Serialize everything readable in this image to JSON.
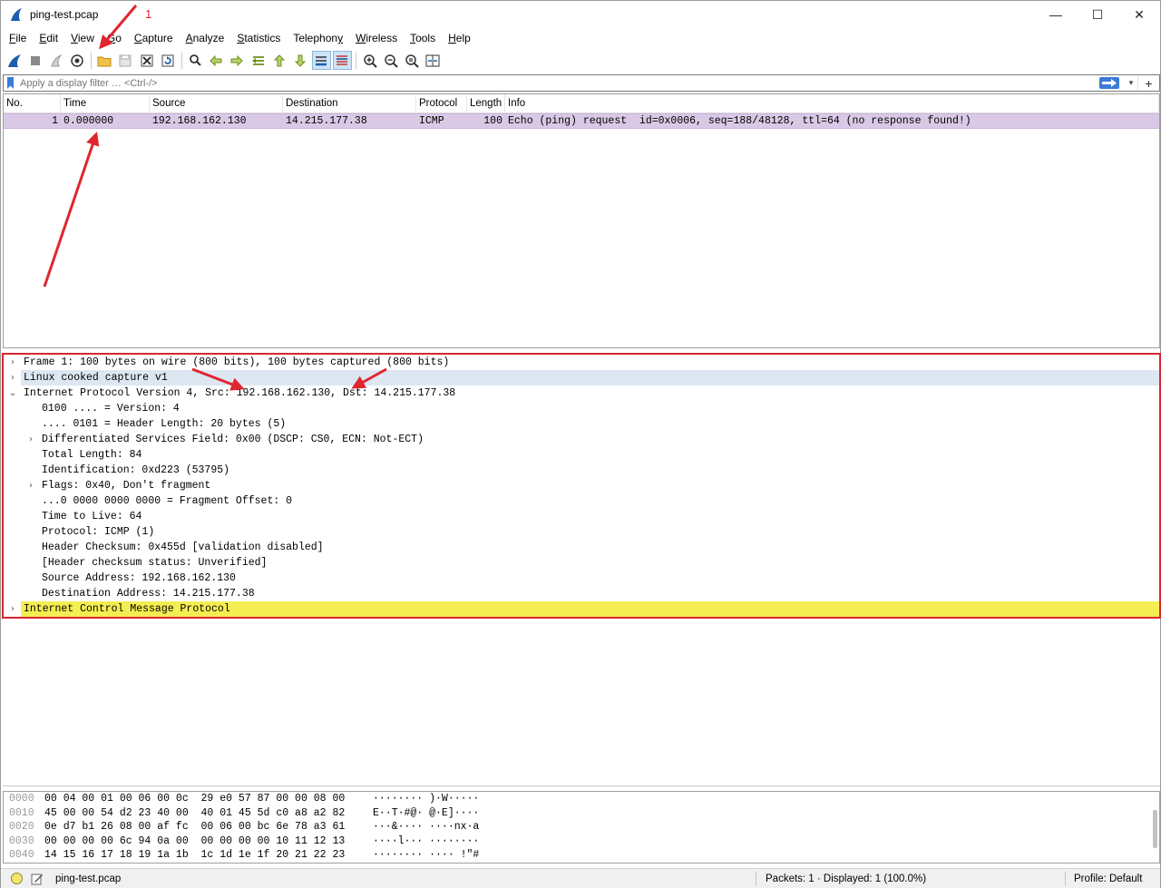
{
  "window": {
    "title": "ping-test.pcap",
    "controls": [
      "—",
      "☐",
      "✕"
    ]
  },
  "menu": [
    {
      "pre": "",
      "u": "F",
      "post": "ile"
    },
    {
      "pre": "",
      "u": "E",
      "post": "dit"
    },
    {
      "pre": "",
      "u": "V",
      "post": "iew"
    },
    {
      "pre": "",
      "u": "G",
      "post": "o"
    },
    {
      "pre": "",
      "u": "C",
      "post": "apture"
    },
    {
      "pre": "",
      "u": "A",
      "post": "nalyze"
    },
    {
      "pre": "",
      "u": "S",
      "post": "tatistics"
    },
    {
      "pre": "Telephon",
      "u": "y",
      "post": ""
    },
    {
      "pre": "",
      "u": "W",
      "post": "ireless"
    },
    {
      "pre": "",
      "u": "T",
      "post": "ools"
    },
    {
      "pre": "",
      "u": "H",
      "post": "elp"
    }
  ],
  "toolbar": {
    "icons": [
      "shark-fin-start-icon",
      "stop-capture-icon",
      "restart-capture-icon",
      "capture-options-icon",
      "|",
      "open-file-icon",
      "save-file-icon",
      "close-file-icon",
      "reload-file-icon",
      "|",
      "find-packet-icon",
      "go-back-icon",
      "go-forward-icon",
      "go-to-packet-icon",
      "go-first-packet-icon",
      "go-last-packet-icon",
      "autoscroll-icon",
      "colorize-icon",
      "|",
      "zoom-in-icon",
      "zoom-out-icon",
      "normal-size-icon",
      "resize-columns-icon"
    ]
  },
  "filter": {
    "placeholder": "Apply a display filter … <Ctrl-/>"
  },
  "packet_list": {
    "columns": [
      "No.",
      "Time",
      "Source",
      "Destination",
      "Protocol",
      "Length",
      "Info"
    ],
    "rows": [
      {
        "no": "1",
        "time": "0.000000",
        "source": "192.168.162.130",
        "destination": "14.215.177.38",
        "protocol": "ICMP",
        "length": "100",
        "info": "Echo (ping) request  id=0x0006, seq=188/48128, ttl=64 (no response found!)"
      }
    ]
  },
  "details": [
    {
      "text": "Frame 1: 100 bytes on wire (800 bits), 100 bytes captured (800 bits)",
      "indent": 0,
      "expander": ">",
      "hl": ""
    },
    {
      "text": "Linux cooked capture v1",
      "indent": 0,
      "expander": ">",
      "hl": "blue"
    },
    {
      "text": "Internet Protocol Version 4, Src: 192.168.162.130, Dst: 14.215.177.38",
      "indent": 0,
      "expander": "v",
      "hl": ""
    },
    {
      "text": "0100 .... = Version: 4",
      "indent": 1,
      "expander": "",
      "hl": ""
    },
    {
      "text": ".... 0101 = Header Length: 20 bytes (5)",
      "indent": 1,
      "expander": "",
      "hl": ""
    },
    {
      "text": "Differentiated Services Field: 0x00 (DSCP: CS0, ECN: Not-ECT)",
      "indent": 1,
      "expander": ">",
      "hl": ""
    },
    {
      "text": "Total Length: 84",
      "indent": 1,
      "expander": "",
      "hl": ""
    },
    {
      "text": "Identification: 0xd223 (53795)",
      "indent": 1,
      "expander": "",
      "hl": ""
    },
    {
      "text": "Flags: 0x40, Don't fragment",
      "indent": 1,
      "expander": ">",
      "hl": ""
    },
    {
      "text": "...0 0000 0000 0000 = Fragment Offset: 0",
      "indent": 1,
      "expander": "",
      "hl": ""
    },
    {
      "text": "Time to Live: 64",
      "indent": 1,
      "expander": "",
      "hl": ""
    },
    {
      "text": "Protocol: ICMP (1)",
      "indent": 1,
      "expander": "",
      "hl": ""
    },
    {
      "text": "Header Checksum: 0x455d [validation disabled]",
      "indent": 1,
      "expander": "",
      "hl": ""
    },
    {
      "text": "[Header checksum status: Unverified]",
      "indent": 1,
      "expander": "",
      "hl": ""
    },
    {
      "text": "Source Address: 192.168.162.130",
      "indent": 1,
      "expander": "",
      "hl": ""
    },
    {
      "text": "Destination Address: 14.215.177.38",
      "indent": 1,
      "expander": "",
      "hl": ""
    },
    {
      "text": "Internet Control Message Protocol",
      "indent": 0,
      "expander": ">",
      "hl": "yellow"
    }
  ],
  "hex": [
    {
      "offset": "0000",
      "bytes": "00 04 00 01 00 06 00 0c  29 e0 57 87 00 00 08 00",
      "ascii": "········ )·W·····"
    },
    {
      "offset": "0010",
      "bytes": "45 00 00 54 d2 23 40 00  40 01 45 5d c0 a8 a2 82",
      "ascii": "E··T·#@· @·E]····"
    },
    {
      "offset": "0020",
      "bytes": "0e d7 b1 26 08 00 af fc  00 06 00 bc 6e 78 a3 61",
      "ascii": "···&···· ····nx·a"
    },
    {
      "offset": "0030",
      "bytes": "00 00 00 00 6c 94 0a 00  00 00 00 00 10 11 12 13",
      "ascii": "····l··· ········"
    },
    {
      "offset": "0040",
      "bytes": "14 15 16 17 18 19 1a 1b  1c 1d 1e 1f 20 21 22 23",
      "ascii": "········ ···· !\"#"
    }
  ],
  "status": {
    "file": "ping-test.pcap",
    "packets": "Packets: 1 · Displayed: 1 (100.0%)",
    "profile": "Profile: Default"
  },
  "annotation": {
    "step_number": "1",
    "color": "#e0262f"
  }
}
